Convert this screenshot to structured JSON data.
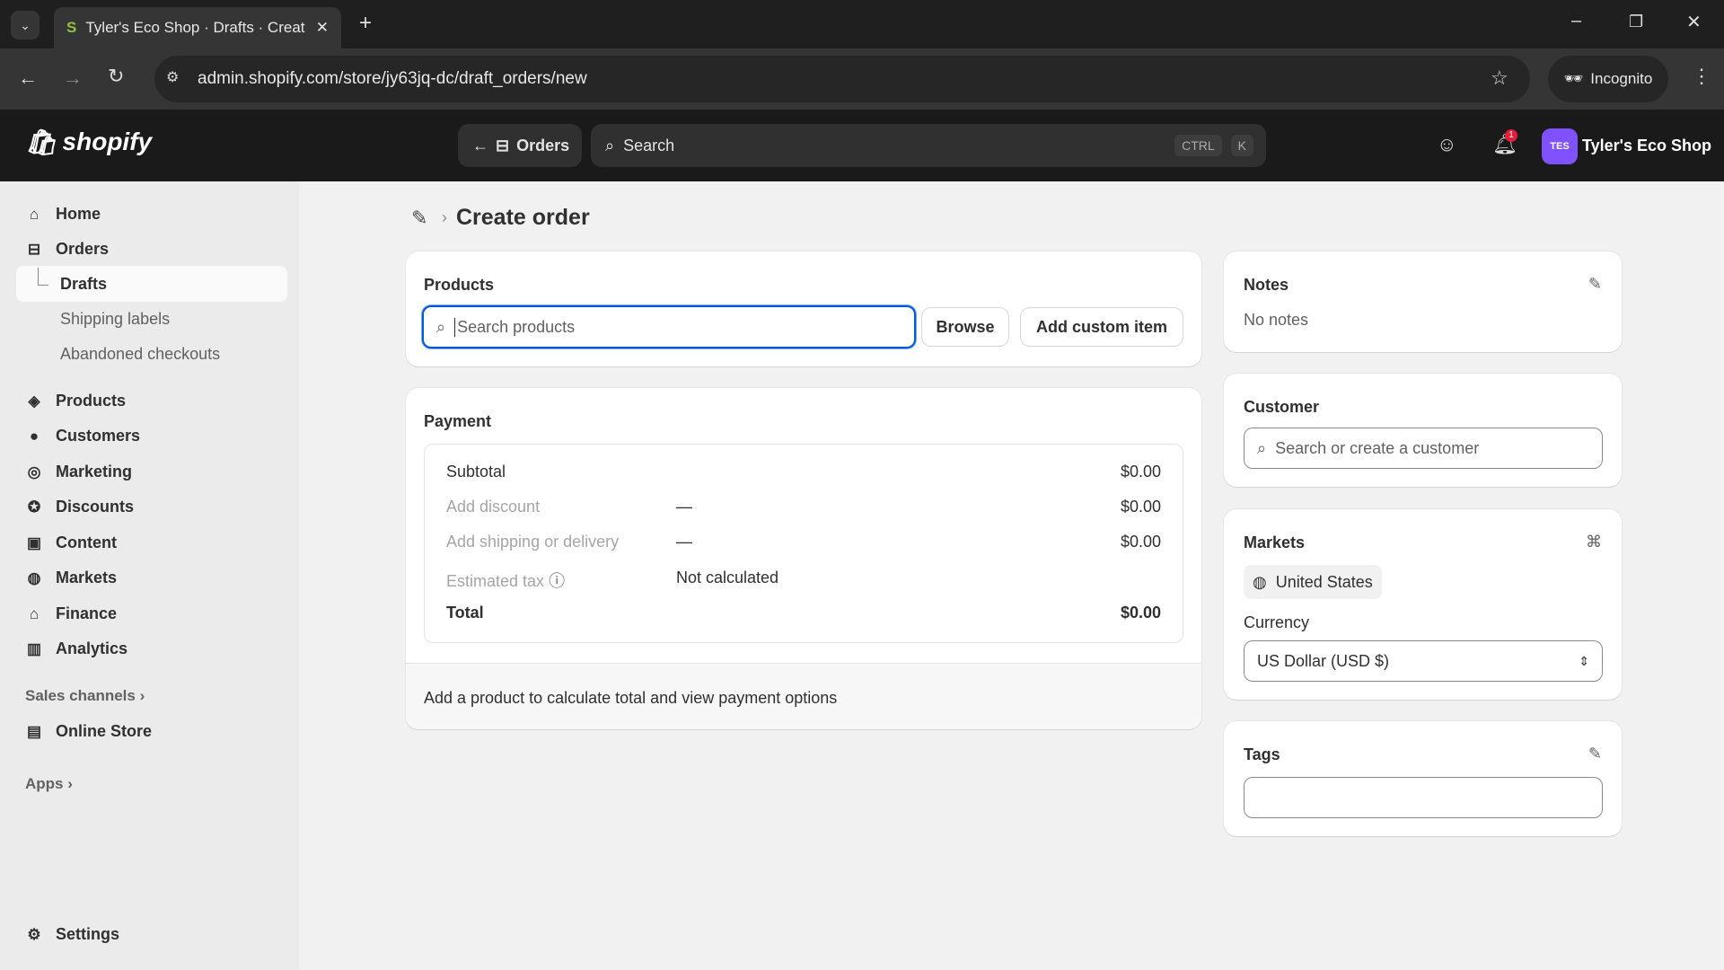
{
  "browser": {
    "tab_title": "Tyler's Eco Shop · Drafts · Creat",
    "url": "admin.shopify.com/store/jy63jq-dc/draft_orders/new",
    "incognito_label": "Incognito"
  },
  "topbar": {
    "logo": "shopify",
    "back_label": "Orders",
    "search_placeholder": "Search",
    "shortcut_1": "CTRL",
    "shortcut_2": "K",
    "notification_count": "1",
    "avatar_initials": "TES",
    "store_name": "Tyler's Eco Shop"
  },
  "sidebar": {
    "items": [
      {
        "label": "Home"
      },
      {
        "label": "Orders"
      },
      {
        "label": "Drafts"
      },
      {
        "label": "Shipping labels"
      },
      {
        "label": "Abandoned checkouts"
      },
      {
        "label": "Products"
      },
      {
        "label": "Customers"
      },
      {
        "label": "Marketing"
      },
      {
        "label": "Discounts"
      },
      {
        "label": "Content"
      },
      {
        "label": "Markets"
      },
      {
        "label": "Finance"
      },
      {
        "label": "Analytics"
      }
    ],
    "sales_channels": "Sales channels",
    "online_store": "Online Store",
    "apps": "Apps",
    "settings": "Settings"
  },
  "page": {
    "title": "Create order"
  },
  "products": {
    "title": "Products",
    "search_placeholder": "Search products",
    "browse": "Browse",
    "add_custom": "Add custom item"
  },
  "payment": {
    "title": "Payment",
    "rows": [
      {
        "label": "Subtotal",
        "mid": "",
        "value": "$0.00"
      },
      {
        "label": "Add discount",
        "mid": "—",
        "value": "$0.00"
      },
      {
        "label": "Add shipping or delivery",
        "mid": "—",
        "value": "$0.00"
      },
      {
        "label": "Estimated tax",
        "mid": "Not calculated",
        "value": ""
      },
      {
        "label": "Total",
        "mid": "",
        "value": "$0.00"
      }
    ],
    "footer": "Add a product to calculate total and view payment options"
  },
  "notes": {
    "title": "Notes",
    "value": "No notes"
  },
  "customer": {
    "title": "Customer",
    "placeholder": "Search or create a customer"
  },
  "markets": {
    "title": "Markets",
    "market": "United States",
    "currency_label": "Currency",
    "currency": "US Dollar (USD $)"
  },
  "tags": {
    "title": "Tags",
    "value": ""
  }
}
